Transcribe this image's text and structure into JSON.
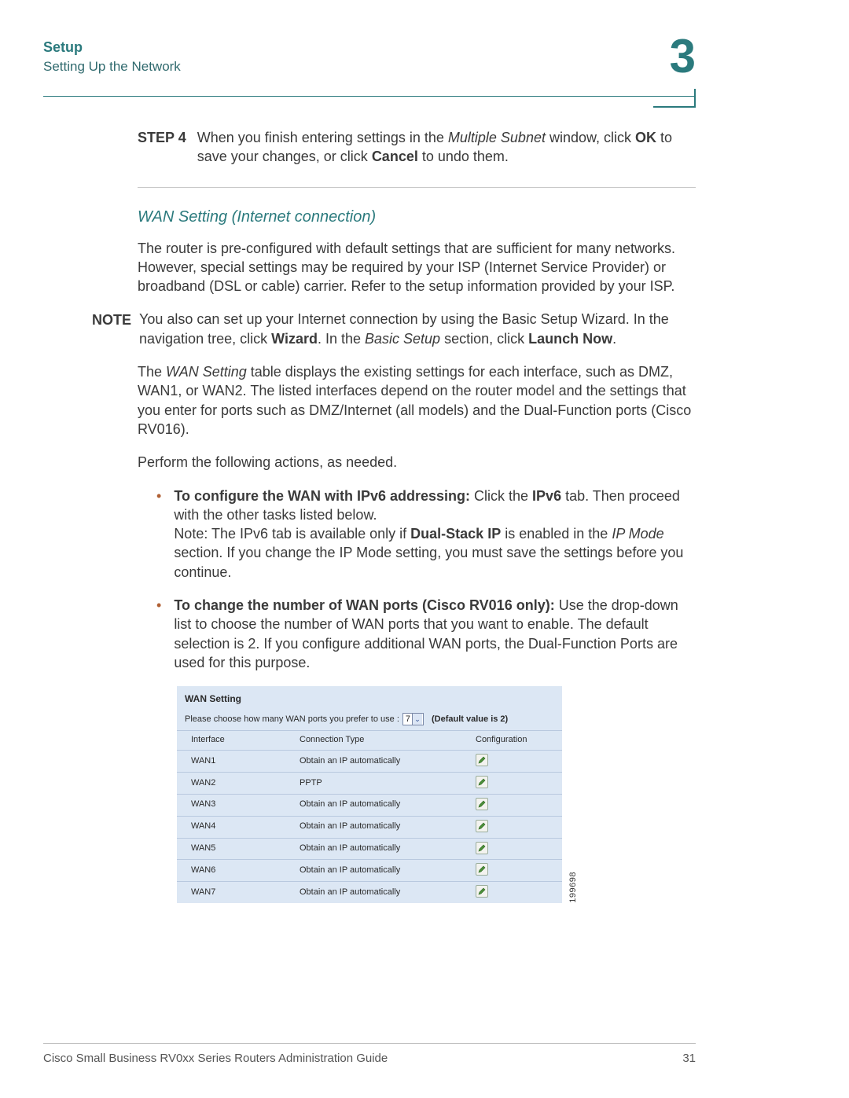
{
  "header": {
    "title": "Setup",
    "subtitle": "Setting Up the Network",
    "chapter": "3"
  },
  "step": {
    "label": "STEP  4",
    "pre": "When you finish entering settings in the ",
    "italic": "Multiple Subnet",
    "mid": " window, click ",
    "bold1": "OK",
    "mid2": " to save your changes, or click ",
    "bold2": "Cancel",
    "post": " to undo them."
  },
  "section_heading": "WAN Setting (Internet connection)",
  "para1": "The router is pre-configured with default settings that are sufficient for many networks. However, special settings may be required by your ISP (Internet Service Provider) or broadband (DSL or cable) carrier. Refer to the setup information provided by your ISP.",
  "note": {
    "label": "NOTE",
    "pre": "You also can set up your Internet connection by using the Basic Setup Wizard. In the navigation tree, click ",
    "bold1": "Wizard",
    "mid": ". In the ",
    "italic": "Basic Setup",
    "mid2": " section, click ",
    "bold2": "Launch Now",
    "post": "."
  },
  "para2": {
    "pre": "The ",
    "italic": "WAN Setting",
    "post": " table displays the existing settings for each interface, such as DMZ, WAN1, or WAN2. The listed interfaces depend on the router model and the settings that you enter for ports such as DMZ/Internet (all models) and the Dual-Function ports (Cisco RV016)."
  },
  "para3": "Perform the following actions, as needed.",
  "bullet1": {
    "b1": "To configure the WAN with IPv6 addressing:",
    "t1": " Click the ",
    "b2": "IPv6",
    "t2": " tab. Then proceed with the other tasks listed below.",
    "br": "Note: The IPv6 tab is available only if ",
    "b3": "Dual-Stack IP",
    "t3": " is enabled in the ",
    "i1": "IP Mode",
    "t4": " section. If you change the IP Mode setting, you must save the settings before you continue."
  },
  "bullet2": {
    "b1": "To change the number of WAN ports (Cisco RV016 only):",
    "t1": " Use the drop-down list to choose the number of WAN ports that you want to enable. The default selection is 2. If you configure additional WAN ports, the Dual-Function Ports are used for this purpose."
  },
  "wan": {
    "title": "WAN Setting",
    "prompt": "Please choose how many WAN ports you prefer to use :",
    "selected": "7",
    "default_note": "(Default value is 2)",
    "headers": {
      "c1": "Interface",
      "c2": "Connection Type",
      "c3": "Configuration"
    },
    "rows": [
      {
        "if": "WAN1",
        "ct": "Obtain an IP automatically"
      },
      {
        "if": "WAN2",
        "ct": "PPTP"
      },
      {
        "if": "WAN3",
        "ct": "Obtain an IP automatically"
      },
      {
        "if": "WAN4",
        "ct": "Obtain an IP automatically"
      },
      {
        "if": "WAN5",
        "ct": "Obtain an IP automatically"
      },
      {
        "if": "WAN6",
        "ct": "Obtain an IP automatically"
      },
      {
        "if": "WAN7",
        "ct": "Obtain an IP automatically"
      }
    ],
    "image_id": "199698"
  },
  "footer": {
    "left": "Cisco Small Business RV0xx Series Routers Administration Guide",
    "right": "31"
  }
}
